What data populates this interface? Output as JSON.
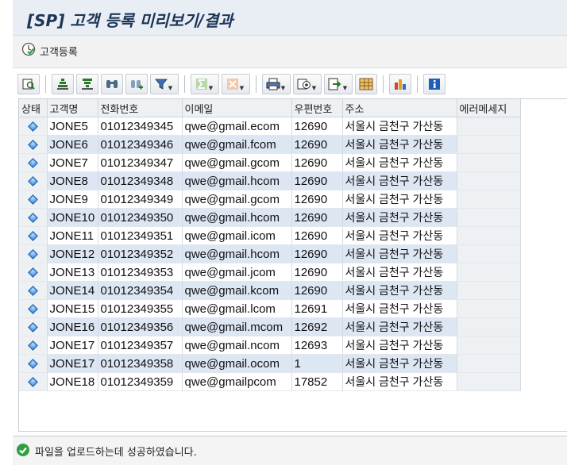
{
  "window": {
    "title": "[SP] 고객 등록 미리보기/결과"
  },
  "app_toolbar": {
    "register_button_label": "고객등록"
  },
  "alv_toolbar": {
    "buttons": [
      "details-icon",
      "sort-ascending-icon",
      "sort-descending-icon",
      "find-icon",
      "find-next-icon",
      "filter-icon",
      "sum-icon",
      "subtotal-icon",
      "print-icon",
      "views-icon",
      "export-icon",
      "layout-icon",
      "graphic-icon",
      "info-icon"
    ]
  },
  "table": {
    "columns": [
      "상태",
      "고객명",
      "전화번호",
      "이메일",
      "우편번호",
      "주소",
      "에러메세지"
    ],
    "rows": [
      {
        "name": "JONE5",
        "phone": "01012349345",
        "email": "qwe@gmail.ecom",
        "zip": "12690",
        "address": "서울시 금천구 가산동",
        "error": ""
      },
      {
        "name": "JONE6",
        "phone": "01012349346",
        "email": "qwe@gmail.fcom",
        "zip": "12690",
        "address": "서울시 금천구 가산동",
        "error": ""
      },
      {
        "name": "JONE7",
        "phone": "01012349347",
        "email": "qwe@gmail.gcom",
        "zip": "12690",
        "address": "서울시 금천구 가산동",
        "error": ""
      },
      {
        "name": "JONE8",
        "phone": "01012349348",
        "email": "qwe@gmail.hcom",
        "zip": "12690",
        "address": "서울시 금천구 가산동",
        "error": ""
      },
      {
        "name": "JONE9",
        "phone": "01012349349",
        "email": "qwe@gmail.gcom",
        "zip": "12690",
        "address": "서울시 금천구 가산동",
        "error": ""
      },
      {
        "name": "JONE10",
        "phone": "01012349350",
        "email": "qwe@gmail.hcom",
        "zip": "12690",
        "address": "서울시 금천구 가산동",
        "error": ""
      },
      {
        "name": "JONE11",
        "phone": "01012349351",
        "email": "qwe@gmail.icom",
        "zip": "12690",
        "address": "서울시 금천구 가산동",
        "error": ""
      },
      {
        "name": "JONE12",
        "phone": "01012349352",
        "email": "qwe@gmail.hcom",
        "zip": "12690",
        "address": "서울시 금천구 가산동",
        "error": ""
      },
      {
        "name": "JONE13",
        "phone": "01012349353",
        "email": "qwe@gmail.jcom",
        "zip": "12690",
        "address": "서울시 금천구 가산동",
        "error": ""
      },
      {
        "name": "JONE14",
        "phone": "01012349354",
        "email": "qwe@gmail.kcom",
        "zip": "12690",
        "address": "서울시 금천구 가산동",
        "error": ""
      },
      {
        "name": "JONE15",
        "phone": "01012349355",
        "email": "qwe@gmail.lcom",
        "zip": "12691",
        "address": "서울시 금천구 가산동",
        "error": ""
      },
      {
        "name": "JONE16",
        "phone": "01012349356",
        "email": "qwe@gmail.mcom",
        "zip": "12692",
        "address": "서울시 금천구 가산동",
        "error": ""
      },
      {
        "name": "JONE17",
        "phone": "01012349357",
        "email": "qwe@gmail.ncom",
        "zip": "12693",
        "address": "서울시 금천구 가산동",
        "error": ""
      },
      {
        "name": "JONE17",
        "phone": "01012349358",
        "email": "qwe@gmail.ocom",
        "zip": "1",
        "address": "서울시 금천구 가산동",
        "error": ""
      },
      {
        "name": "JONE18",
        "phone": "01012349359",
        "email": "qwe@gmailpcom",
        "zip": "17852",
        "address": "서울시 금천구 가산동",
        "error": ""
      }
    ]
  },
  "status_bar": {
    "message": "파일을 업로드하는데 성공하였습니다."
  },
  "colors": {
    "title_text": "#1c3557",
    "row_alt": "#dde6f3",
    "status_diamond": "#2f7fd6",
    "success_green": "#2ea043"
  }
}
